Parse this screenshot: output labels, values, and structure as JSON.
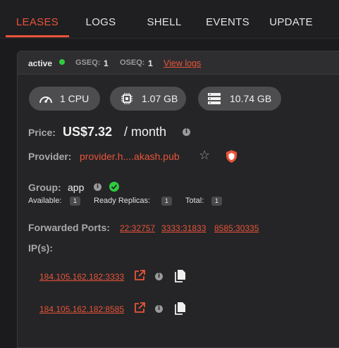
{
  "tabs": [
    {
      "label": "LEASES",
      "active": true
    },
    {
      "label": "LOGS",
      "active": false
    },
    {
      "label": "SHELL",
      "active": false
    },
    {
      "label": "EVENTS",
      "active": false
    },
    {
      "label": "UPDATE",
      "active": false
    }
  ],
  "lease": {
    "status": "active",
    "gseq_label": "GSEQ:",
    "gseq_value": "1",
    "oseq_label": "OSEQ:",
    "oseq_value": "1",
    "view_logs": "View logs"
  },
  "resources": {
    "cpu": "1 CPU",
    "memory": "1.07 GB",
    "storage": "10.74 GB"
  },
  "price": {
    "label": "Price:",
    "amount": "US$7.32",
    "period": "/ month"
  },
  "provider": {
    "label": "Provider:",
    "value": "provider.h....akash.pub"
  },
  "group": {
    "label": "Group:",
    "value": "app",
    "available_label": "Available:",
    "available_value": "1",
    "ready_label": "Ready Replicas:",
    "ready_value": "1",
    "total_label": "Total:",
    "total_value": "1"
  },
  "ports": {
    "label": "Forwarded Ports:",
    "items": [
      "22:32757",
      "3333:31833",
      "8585:30335"
    ]
  },
  "ips": {
    "label": "IP(s):",
    "items": [
      "184.105.162.182:3333",
      "184.105.162.182:8585"
    ]
  },
  "colors": {
    "accent": "#e8543a",
    "status_active": "#2ecc40",
    "shield": "#e8543a"
  },
  "icons": [
    "speedometer-icon",
    "chip-icon",
    "storage-icon",
    "info-icon",
    "star-icon",
    "shield-icon",
    "check-circle-icon",
    "external-link-icon",
    "copy-icon"
  ]
}
